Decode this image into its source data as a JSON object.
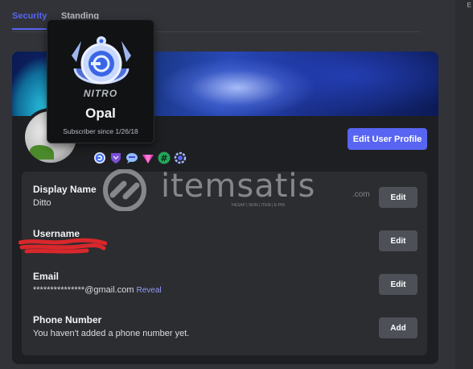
{
  "tabs": [
    {
      "label": "Security",
      "active": true
    },
    {
      "label": "Standing",
      "active": false
    }
  ],
  "corner_mark": "E",
  "profile": {
    "edit_button": "Edit User Profile"
  },
  "badges": [
    "nitro-opal-icon",
    "shield-badge-icon",
    "speech-bubble-badge-icon",
    "gem-badge-icon",
    "hashtag-badge-icon",
    "quest-badge-icon"
  ],
  "tooltip": {
    "brand": "NITRO",
    "tier": "Opal",
    "subscriber_since": "Subscriber since 1/26/18"
  },
  "fields": [
    {
      "label": "Display Name",
      "value": "Ditto",
      "button": "Edit"
    },
    {
      "label": "Username",
      "value": "",
      "button": "Edit"
    },
    {
      "label": "Email",
      "value": "***************@gmail.com",
      "reveal": "Reveal",
      "button": "Edit"
    },
    {
      "label": "Phone Number",
      "value": "You haven't added a phone number yet.",
      "button": "Add"
    }
  ],
  "watermark": {
    "text": "itemsatis",
    "com": ".com",
    "small": "HESAP | SKIN | ITEM | E-PIN"
  },
  "colors": {
    "accent": "#5865f2",
    "card": "#1e1f22",
    "panel": "#2b2d31",
    "button": "#4e5058",
    "scribble": "#d9272b"
  }
}
